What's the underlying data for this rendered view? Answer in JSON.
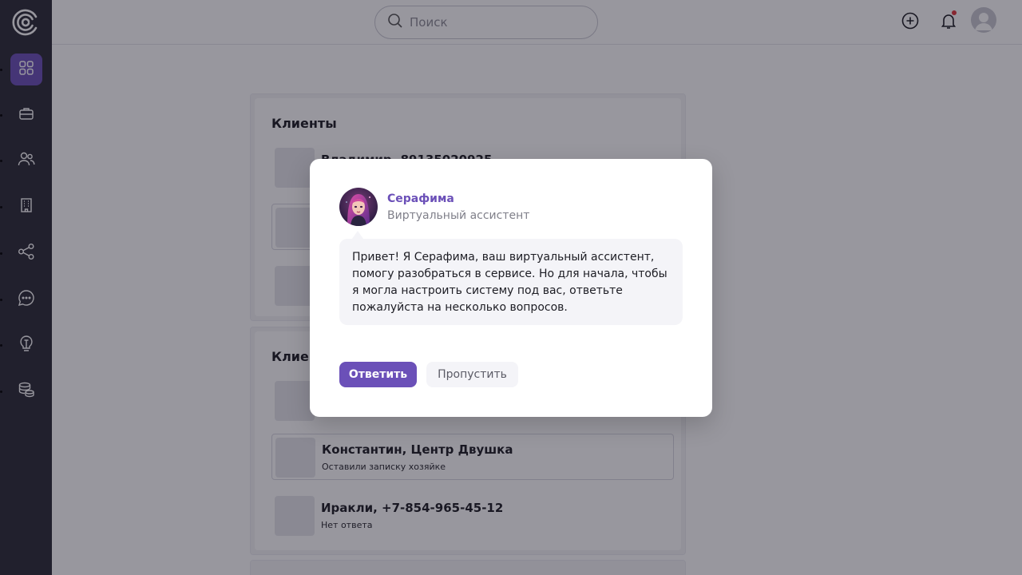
{
  "search": {
    "placeholder": "Поиск"
  },
  "panels": [
    {
      "title": "Клиенты",
      "clients": [
        {
          "name": "Владимир, 89135020925",
          "sub": ""
        },
        {
          "name": "",
          "sub": ""
        },
        {
          "name": "",
          "sub": ""
        }
      ]
    },
    {
      "title": "Клиенты",
      "clients": [
        {
          "name": "",
          "sub": ""
        },
        {
          "name": "Константин, Центр Двушка",
          "sub": "Оставили записку хозяйке"
        },
        {
          "name": "Иракли, +7-854-965-45-12",
          "sub": "Нет ответа"
        }
      ]
    }
  ],
  "modal": {
    "assistant_name": "Серафима",
    "assistant_role": "Виртуальный ассистент",
    "message": "Привет! Я Серафима, ваш виртуальный ассистент, помогу разобраться в сервисе. Но для начала, чтобы я могла настроить систему под вас, ответьте пожалуйста на несколько вопросов.",
    "answer_label": "Ответить",
    "skip_label": "Пропустить"
  },
  "colors": {
    "accent": "#6b50b8",
    "sidebar_bg": "#2c2b36",
    "notification": "#e0383e"
  },
  "icons": {
    "logo": "spiral-logo-icon",
    "nav": [
      "dashboard-icon",
      "briefcase-icon",
      "users-icon",
      "building-icon",
      "share-icon",
      "chat-icon",
      "lightbulb-icon",
      "database-icon"
    ],
    "top": [
      "add-circle-icon",
      "bell-icon",
      "user-avatar-icon"
    ]
  }
}
